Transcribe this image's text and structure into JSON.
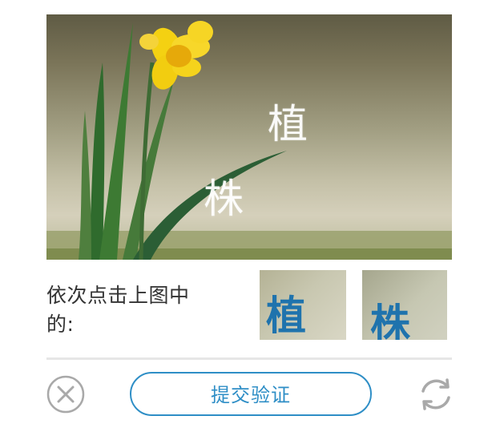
{
  "captcha": {
    "image": {
      "overlay_glyphs": [
        "植",
        "株"
      ]
    },
    "instruction": "依次点击上图中的:",
    "targets": [
      {
        "char": "植"
      },
      {
        "char": "株"
      }
    ],
    "submit_label": "提交验证",
    "colors": {
      "accent": "#2e8ec6",
      "icon_gray": "#a9a9a9",
      "divider": "#e6e6e6"
    },
    "icons": {
      "close": "close-circle-icon",
      "refresh": "refresh-icon"
    }
  }
}
